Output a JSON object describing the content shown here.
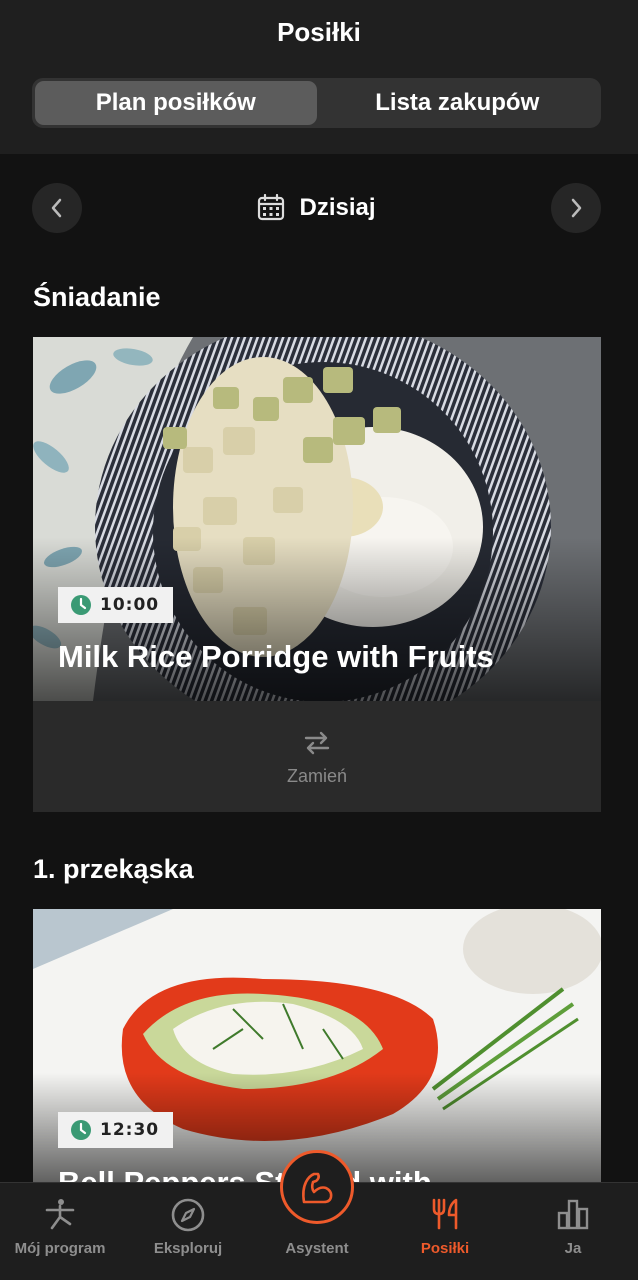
{
  "header": {
    "title": "Posiłki",
    "tabs": [
      {
        "label": "Plan posiłków",
        "active": true
      },
      {
        "label": "Lista zakupów",
        "active": false
      }
    ]
  },
  "date_nav": {
    "label": "Dzisiaj",
    "prev_icon": "chevron-left-icon",
    "next_icon": "chevron-right-icon",
    "calendar_icon": "calendar-icon"
  },
  "meals": [
    {
      "section": "Śniadanie",
      "time": "10:00",
      "title": "Milk Rice Porridge with Fruits",
      "swap_label": "Zamień"
    },
    {
      "section": "1. przekąska",
      "time": "12:30",
      "title": "Bell Peppers Stuffed with"
    }
  ],
  "tabbar": {
    "items": [
      {
        "label": "Mój program",
        "icon": "fitness-figure-icon"
      },
      {
        "label": "Eksploruj",
        "icon": "compass-icon"
      },
      {
        "label": "Asystent",
        "icon": "flexed-arm-icon"
      },
      {
        "label": "Posiłki",
        "icon": "fork-knife-icon",
        "active": true
      },
      {
        "label": "Ja",
        "icon": "bar-chart-icon"
      }
    ]
  },
  "colors": {
    "accent": "#ee5a2b",
    "background": "#121212",
    "clock_green": "#3a9a74"
  }
}
